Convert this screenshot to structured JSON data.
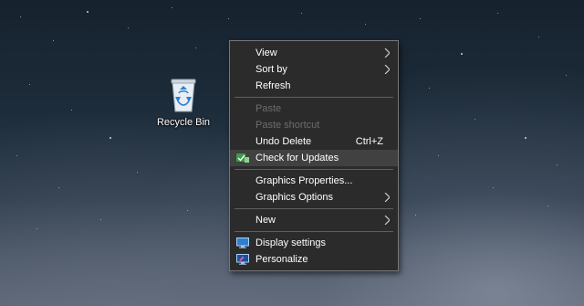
{
  "desktop": {
    "icons": [
      {
        "label": "Recycle Bin",
        "icon": "recycle-bin-icon"
      }
    ]
  },
  "context_menu": {
    "items": [
      {
        "label": "View",
        "submenu": true,
        "icon": "chevron-right-icon"
      },
      {
        "label": "Sort by",
        "submenu": true,
        "icon": "chevron-right-icon"
      },
      {
        "label": "Refresh"
      },
      {
        "label": "Paste",
        "disabled": true
      },
      {
        "label": "Paste shortcut",
        "disabled": true
      },
      {
        "label": "Undo Delete",
        "shortcut": "Ctrl+Z"
      },
      {
        "label": "Check for Updates",
        "icon": "update-shield-icon",
        "highlighted": true
      },
      {
        "label": "Graphics Properties..."
      },
      {
        "label": "Graphics Options",
        "submenu": true,
        "icon": "chevron-right-icon"
      },
      {
        "label": "New",
        "submenu": true,
        "icon": "chevron-right-icon"
      },
      {
        "label": "Display settings",
        "icon": "display-icon"
      },
      {
        "label": "Personalize",
        "icon": "personalize-icon"
      }
    ]
  },
  "colors": {
    "menu_background": "#2b2b2b",
    "menu_border": "#777777",
    "disabled_text": "#6d6d6d",
    "highlight": "#414141",
    "accent_icon": "#3a7bd5"
  }
}
